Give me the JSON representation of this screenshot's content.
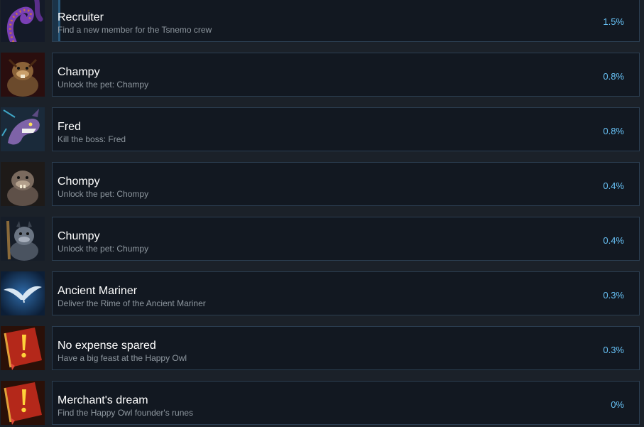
{
  "achievements": [
    {
      "title": "Recruiter",
      "description": "Find a new member for the Tsnemo crew",
      "percent": "1.5%",
      "progress": 0.015,
      "icon": "tentacle-icon"
    },
    {
      "title": "Champy",
      "description": "Unlock the pet: Champy",
      "percent": "0.8%",
      "progress": 0.008,
      "icon": "champy-pet-icon"
    },
    {
      "title": "Fred",
      "description": "Kill the boss: Fred",
      "percent": "0.8%",
      "progress": 0.008,
      "icon": "fred-dragon-icon"
    },
    {
      "title": "Chompy",
      "description": "Unlock the pet: Chompy",
      "percent": "0.4%",
      "progress": 0.004,
      "icon": "chompy-pet-icon"
    },
    {
      "title": "Chumpy",
      "description": "Unlock the pet: Chumpy",
      "percent": "0.4%",
      "progress": 0.004,
      "icon": "chumpy-pet-icon"
    },
    {
      "title": "Ancient Mariner",
      "description": "Deliver the Rime of the Ancient Mariner",
      "percent": "0.3%",
      "progress": 0.003,
      "icon": "albatross-icon"
    },
    {
      "title": "No expense spared",
      "description": "Have a big feast at the Happy Owl",
      "percent": "0.3%",
      "progress": 0.003,
      "icon": "red-book-exclamation-icon"
    },
    {
      "title": "Merchant's dream",
      "description": "Find the Happy Owl founder's runes",
      "percent": "0%",
      "progress": 0,
      "icon": "red-book-exclamation-icon"
    }
  ],
  "colors": {
    "background": "#1b2129",
    "card": "#121821",
    "card_border": "#2b3e51",
    "progress_fill": "#1b3348",
    "percent_text": "#67c1f5",
    "title_text": "#ffffff",
    "description_text": "#8f98a0"
  }
}
